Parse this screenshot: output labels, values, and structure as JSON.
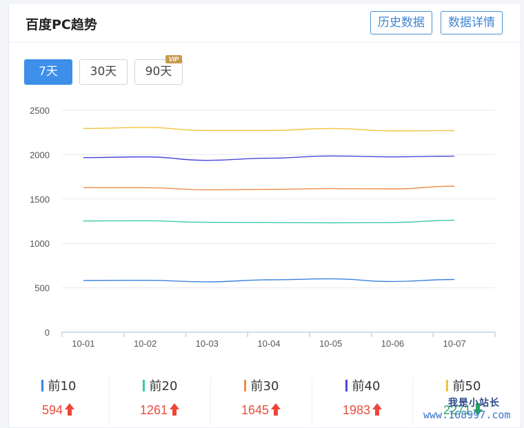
{
  "header": {
    "title": "百度PC趋势",
    "history_button": "历史数据",
    "detail_button": "数据详情"
  },
  "tabs": [
    {
      "label": "7天",
      "active": true
    },
    {
      "label": "30天",
      "active": false
    },
    {
      "label": "90天",
      "active": false,
      "badge": "VIP"
    }
  ],
  "chart_data": {
    "type": "line",
    "categories": [
      "10-01",
      "10-02",
      "10-03",
      "10-04",
      "10-05",
      "10-06",
      "10-07"
    ],
    "yticks": [
      0,
      500,
      1000,
      1500,
      2000,
      2500
    ],
    "ylim": [
      0,
      2500
    ],
    "grid": true,
    "series": [
      {
        "name": "前10",
        "color": "#3b82e0",
        "values": [
          582,
          585,
          567,
          590,
          601,
          571,
          594
        ]
      },
      {
        "name": "前20",
        "color": "#3cc9a8",
        "values": [
          1253,
          1255,
          1238,
          1236,
          1232,
          1236,
          1261
        ]
      },
      {
        "name": "前30",
        "color": "#ef8d4a",
        "values": [
          1628,
          1628,
          1604,
          1609,
          1618,
          1614,
          1645
        ]
      },
      {
        "name": "前40",
        "color": "#4a48d8",
        "values": [
          1967,
          1975,
          1936,
          1960,
          1985,
          1975,
          1983
        ]
      },
      {
        "name": "前50",
        "color": "#f0c33c",
        "values": [
          2295,
          2306,
          2272,
          2272,
          2295,
          2268,
          2271
        ]
      }
    ]
  },
  "legend": [
    {
      "name": "前10",
      "value": "594",
      "color": "#3b82e0"
    },
    {
      "name": "前20",
      "value": "1261",
      "color": "#3cc9a8"
    },
    {
      "name": "前30",
      "value": "1645",
      "color": "#ef8d4a"
    },
    {
      "name": "前40",
      "value": "1983",
      "color": "#4a48d8"
    },
    {
      "name": "前50",
      "value": "2271",
      "color": "#f0c33c",
      "trend": "down"
    }
  ],
  "watermark": {
    "line1": "我是小站长",
    "line2": "www.168997.com"
  }
}
